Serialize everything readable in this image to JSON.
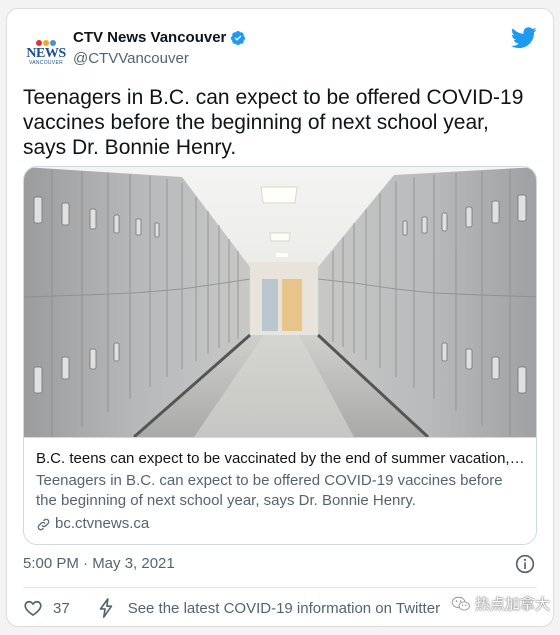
{
  "account": {
    "display_name": "CTV News Vancouver",
    "handle": "@CTVVancouver",
    "avatar_logo_word": "NEWS",
    "avatar_logo_sub": "VANCOUVER",
    "avatar_logo_top": "CTV"
  },
  "tweet": {
    "text": "Teenagers in B.C. can expect to be offered COVID-19 vaccines before the beginning of next school year, says Dr. Bonnie Henry.",
    "timestamp": "5:00 PM · May 3, 2021"
  },
  "link_card": {
    "title": "B.C. teens can expect to be vaccinated by the end of summer vacation,…",
    "description": "Teenagers in B.C. can expect to be offered COVID-19 vaccines before the beginning of next school year, says Dr. Bonnie Henry.",
    "domain": "bc.ctvnews.ca",
    "image_subject": "school-hallway-with-lockers"
  },
  "engagement": {
    "likes": "37",
    "cta": "See the latest COVID-19 information on Twitter"
  },
  "watermark": {
    "text": "热点加拿大"
  },
  "icons": {
    "verified": "verified-badge-icon",
    "bird": "twitter-bird-icon",
    "info": "info-icon",
    "heart": "heart-icon",
    "bolt": "lightning-bolt-icon",
    "link": "link-icon",
    "wechat": "wechat-icon"
  },
  "colors": {
    "twitter_blue": "#1d9bf0",
    "text_primary": "#0f1419",
    "text_secondary": "#536471",
    "border": "#cfd9de"
  }
}
